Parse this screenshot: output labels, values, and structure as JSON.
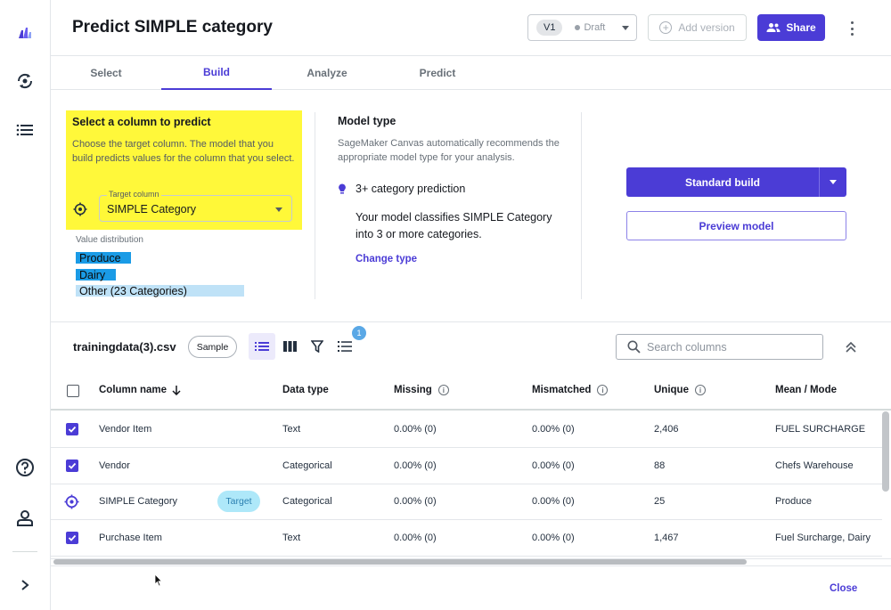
{
  "app": {
    "title": "Predict SIMPLE category"
  },
  "header": {
    "version": "V1",
    "status": "Draft",
    "add_version": "Add version",
    "share": "Share"
  },
  "tabs": [
    {
      "label": "Select",
      "active": false
    },
    {
      "label": "Build",
      "active": true
    },
    {
      "label": "Analyze",
      "active": false
    },
    {
      "label": "Predict",
      "active": false
    }
  ],
  "target": {
    "heading": "Select a column to predict",
    "description": "Choose the target column. The model that you build predicts values for the column that you select.",
    "select_label": "Target column",
    "select_value": "SIMPLE Category",
    "distribution_title": "Value distribution",
    "distribution": [
      {
        "label": "Produce",
        "fraction": 0.32,
        "color": "#1a9be6"
      },
      {
        "label": "Dairy",
        "fraction": 0.23,
        "color": "#1a9be6"
      },
      {
        "label": "Other (23 Categories)",
        "fraction": 0.97,
        "color": "#bfe2f7"
      }
    ]
  },
  "model_type": {
    "heading": "Model type",
    "description": "SageMaker Canvas automatically recommends the appropriate model type for your analysis.",
    "category": "3+ category prediction",
    "body": "Your model classifies SIMPLE Category into 3 or more categories.",
    "change_link": "Change type"
  },
  "actions": {
    "build": "Standard build",
    "preview": "Preview model"
  },
  "dataset": {
    "name": "trainingdata(3).csv",
    "sample": "Sample",
    "filter_badge": "1",
    "search_placeholder": "Search columns"
  },
  "table": {
    "headers": {
      "column": "Column name",
      "type": "Data type",
      "missing": "Missing",
      "mismatched": "Mismatched",
      "unique": "Unique",
      "mean": "Mean / Mode"
    },
    "rows": [
      {
        "name": "Vendor Item",
        "type": "Text",
        "missing": "0.00% (0)",
        "mismatched": "0.00% (0)",
        "unique": "2,406",
        "mean": "FUEL SURCHARGE",
        "state": "checked"
      },
      {
        "name": "Vendor",
        "type": "Categorical",
        "missing": "0.00% (0)",
        "mismatched": "0.00% (0)",
        "unique": "88",
        "mean": "Chefs Warehouse",
        "state": "checked"
      },
      {
        "name": "SIMPLE Category",
        "badge": "Target",
        "type": "Categorical",
        "missing": "0.00% (0)",
        "mismatched": "0.00% (0)",
        "unique": "25",
        "mean": "Produce",
        "state": "target"
      },
      {
        "name": "Purchase Item",
        "type": "Text",
        "missing": "0.00% (0)",
        "mismatched": "0.00% (0)",
        "unique": "1,467",
        "mean": "Fuel Surcharge, Dairy",
        "state": "checked"
      }
    ]
  },
  "footer": {
    "close": "Close"
  },
  "colors": {
    "accent": "#4b3cd6",
    "highlight": "#fff83a",
    "bar_primary": "#1a9be6",
    "bar_other": "#bfe2f7"
  }
}
